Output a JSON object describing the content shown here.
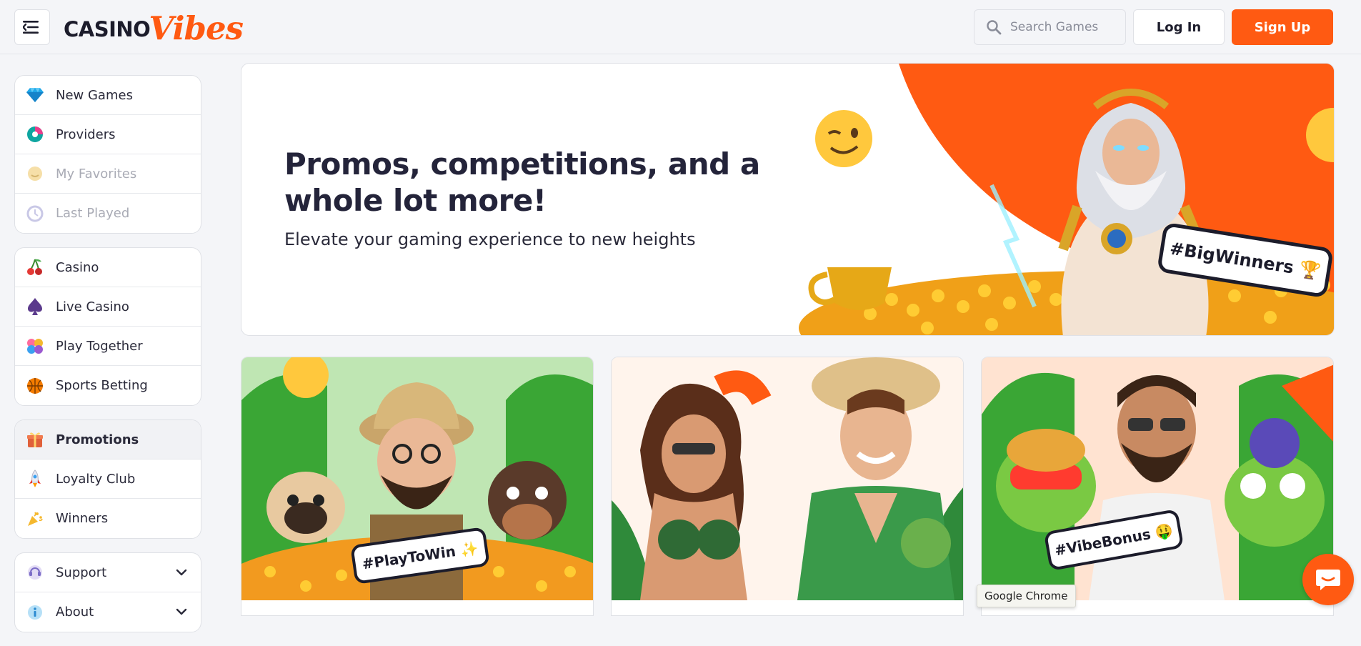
{
  "header": {
    "logo_casino": "CASINO",
    "logo_vibes": "Vibes",
    "search_placeholder": "Search Games",
    "login_label": "Log In",
    "signup_label": "Sign Up"
  },
  "sidebar": {
    "group1": [
      {
        "label": "New Games",
        "icon": "diamond-icon",
        "muted": false
      },
      {
        "label": "Providers",
        "icon": "providers-icon",
        "muted": false
      },
      {
        "label": "My Favorites",
        "icon": "favorites-icon",
        "muted": true
      },
      {
        "label": "Last Played",
        "icon": "last-played-icon",
        "muted": true
      }
    ],
    "group2": [
      {
        "label": "Casino",
        "icon": "cherry-icon"
      },
      {
        "label": "Live Casino",
        "icon": "spade-icon"
      },
      {
        "label": "Play Together",
        "icon": "play-together-icon"
      },
      {
        "label": "Sports Betting",
        "icon": "basketball-icon"
      }
    ],
    "group3": [
      {
        "label": "Promotions",
        "icon": "gift-icon",
        "active": true
      },
      {
        "label": "Loyalty Club",
        "icon": "rocket-icon"
      },
      {
        "label": "Winners",
        "icon": "confetti-icon"
      }
    ],
    "group4": [
      {
        "label": "Support",
        "icon": "support-icon"
      },
      {
        "label": "About",
        "icon": "about-icon"
      }
    ]
  },
  "hero": {
    "title": "Promos, competitions, and a whole lot more!",
    "subtitle": "Elevate your gaming experience to new heights",
    "badge": "#BigWinners 🏆"
  },
  "cards": [
    {
      "badge": "#PlayToWin ✨"
    },
    {
      "badge": ""
    },
    {
      "badge": "#VibeBonus 🤑"
    }
  ],
  "tooltip": "Google Chrome",
  "colors": {
    "accent": "#ff5a12",
    "text": "#24243a",
    "bg": "#f4f5f8"
  }
}
